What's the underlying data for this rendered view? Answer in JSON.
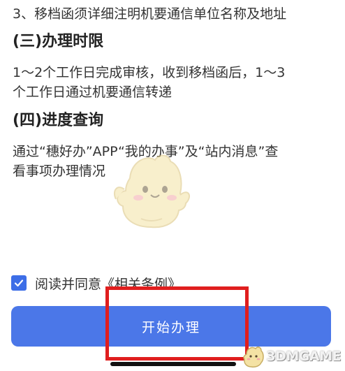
{
  "content": {
    "item3": "3、移档函须详细注明机要通信单位名称及地址",
    "section3_title": "(三)办理时限",
    "section3_line1": "1～2个工作日完成审核，收到移档函后，1～3",
    "section3_line2": "个工作日通过机要通信转递",
    "section4_title": "(四)进度查询",
    "section4_line1": "通过“穗好办”APP“我的办事”及“站内消息”查",
    "section4_line2": "看事项办理情况"
  },
  "agreement": {
    "checked": true,
    "label": "阅读并同意《相关条例》"
  },
  "actions": {
    "start_label": "开始办理"
  },
  "watermark": {
    "text": "3DMGAME"
  },
  "colors": {
    "accent": "#4b77e8",
    "highlight": "#e01e1e"
  }
}
